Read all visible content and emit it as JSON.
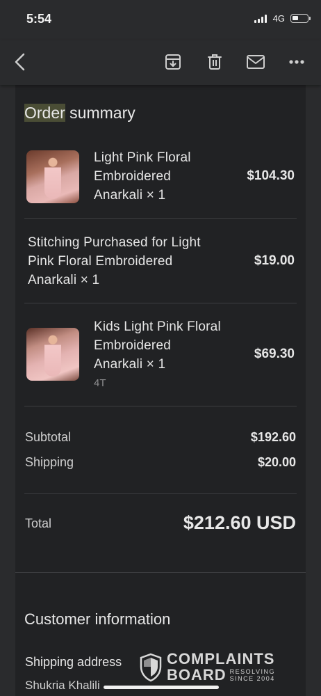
{
  "status": {
    "time": "5:54",
    "network": "4G"
  },
  "toolbar": {
    "icons": [
      "back-icon",
      "archive-icon",
      "trash-icon",
      "mail-icon",
      "more-icon"
    ]
  },
  "order": {
    "title_highlight": "Order",
    "title_rest": " summary",
    "items": [
      {
        "name_lines": [
          "Light Pink Floral",
          "Embroidered",
          "Anarkali × 1"
        ],
        "price": "$104.30",
        "has_image": true
      },
      {
        "name_lines": [
          "Stitching Purchased for Light",
          "Pink Floral Embroidered",
          "Anarkali × 1"
        ],
        "price": "$19.00",
        "has_image": false
      },
      {
        "name_lines": [
          "Kids Light Pink Floral",
          "Embroidered",
          "Anarkali × 1"
        ],
        "variant": "4T",
        "price": "$69.30",
        "has_image": true
      }
    ],
    "subtotal_label": "Subtotal",
    "subtotal_value": "$192.60",
    "shipping_label": "Shipping",
    "shipping_value": "$20.00",
    "total_label": "Total",
    "total_value": "$212.60 USD"
  },
  "customer": {
    "title": "Customer information",
    "shipping_address_label": "Shipping address",
    "name": "Shukria Khalili"
  },
  "watermark": {
    "line1": "COMPLAINTS",
    "line2": "BOARD",
    "tag1": "RESOLVING",
    "tag2": "SINCE 2004"
  },
  "colors": {
    "background": "#2a2b2d",
    "card": "#212224",
    "highlight": "#4a4d35"
  }
}
